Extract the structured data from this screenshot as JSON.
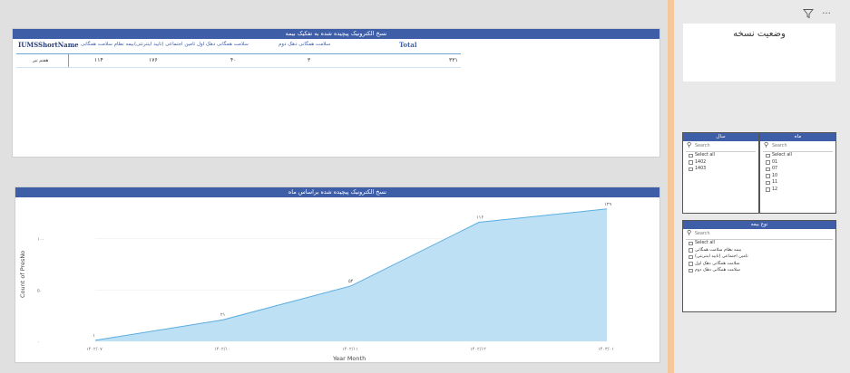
{
  "table_visual": {
    "title": "نسخ الکترونیک پیچیده شده به تفکیک بیمه",
    "headers": {
      "name": "IUMSShortName",
      "col1": "بیمه نظام سلامت همگانی",
      "col2": "تامین اجتماعی (تایید اینترنتی)",
      "col3": "سلامت همگانی دهک اول",
      "col4": "سلامت همگانی دهک دوم",
      "total": "Total"
    },
    "row": {
      "name": "هفتم تیر",
      "col1": "۱۱۴",
      "col2": "۱۷۶",
      "col3": "۴۰",
      "col4": "۳",
      "total": "۳۳۱"
    }
  },
  "chart_visual": {
    "title": "نسخ الکترونیک پیچیده شده براساس ماه",
    "chart_data": {
      "type": "area",
      "x": [
        "۱۴۰۲/۰۷",
        "۱۴۰۲/۱۰",
        "۱۴۰۲/۱۱",
        "۱۴۰۲/۱۲",
        "۱۴۰۳/۰۱"
      ],
      "y_tick_labels": [
        "۰",
        "۵۰",
        "۱۰۰"
      ],
      "points": [
        {
          "x": 0.0,
          "y": 1,
          "label": "۱"
        },
        {
          "x": 1.0,
          "y": 21,
          "label": "۲۱"
        },
        {
          "x": 2.0,
          "y": 54,
          "label": "۵۴"
        },
        {
          "x": 3.0,
          "y": 116,
          "label": "۱۱۶"
        },
        {
          "x": 4.0,
          "y": 129,
          "label": "۱۲۹"
        }
      ],
      "xlabel": "Year Month",
      "ylabel": "Count of PresNo",
      "ylim": [
        0,
        135
      ],
      "fill_color": "#bde0f5",
      "line_color": "#5aaee0"
    }
  },
  "right_panel": {
    "more_icon": "more-options-icon",
    "filter_icon": "filter-icon",
    "status_title": "وضعیت نسخه",
    "year_slicer": {
      "title": "سال",
      "search_placeholder": "Search",
      "items": [
        "Select all",
        "1402",
        "1403"
      ]
    },
    "month_slicer": {
      "title": "ماه",
      "search_placeholder": "Search",
      "items": [
        "Select all",
        "01",
        "07",
        "10",
        "11",
        "12"
      ]
    },
    "insurance_slicer": {
      "title": "نوع بیمه",
      "search_placeholder": "Search",
      "items": [
        "Select all",
        "بیمه نظام سلامت همگانی",
        "تامین اجتماعی (تایید اینترنتی)",
        "سلامت همگانی دهک اول",
        "سلامت همگانی دهک دوم"
      ]
    }
  },
  "colors": {
    "header_blue": "#3e5ea8",
    "divider_orange": "#f6c79a"
  }
}
